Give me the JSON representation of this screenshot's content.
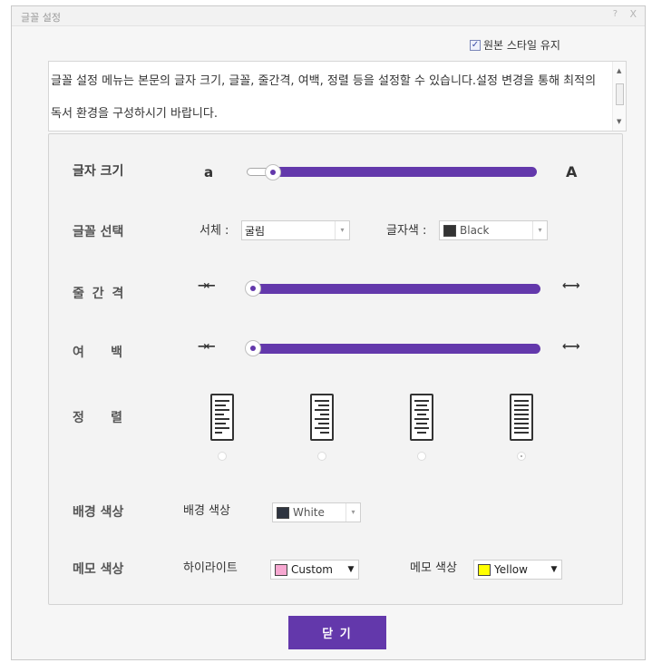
{
  "window": {
    "title": "글꼴 설정",
    "help": "?",
    "close": "X"
  },
  "keep_style": {
    "label": "원본 스타일 유지",
    "checked": true
  },
  "description": {
    "text": "글꼴 설정 메뉴는 본문의 글자 크기, 글꼴, 줄간격, 여백, 정렬 등을 설정할 수 있습니다.설정 변경을 통해 최적의 독서 환경을 구성하시기 바랍니다."
  },
  "font_size": {
    "label": "글자 크기",
    "small": "a",
    "large": "A",
    "level": 0.02
  },
  "font_select": {
    "label": "글꼴 선택",
    "typeface_label": "서체 :",
    "typeface_value": "굴림",
    "color_label": "글자색 :",
    "color_value": "Black",
    "color_swatch": "#333333"
  },
  "line_spacing": {
    "label": "줄 간 격",
    "level": 0.0
  },
  "margin": {
    "label": "여      백",
    "level": 0.0
  },
  "alignment": {
    "label": "정      렬",
    "options": [
      "left",
      "right",
      "center",
      "justify"
    ],
    "selected": "justify"
  },
  "background": {
    "label": "배경 색상",
    "field_label": "배경 색상",
    "value": "White",
    "swatch": "#2e3440"
  },
  "memo": {
    "label": "메모 색상",
    "highlight_label": "하이라이트",
    "highlight_value": "Custom",
    "highlight_swatch": "#f7a8d1",
    "memo_color_label": "메모 색상",
    "memo_color_value": "Yellow",
    "memo_swatch": "#ffff00"
  },
  "close_button": {
    "label": "닫 기"
  },
  "colors": {
    "accent": "#6338ab"
  }
}
